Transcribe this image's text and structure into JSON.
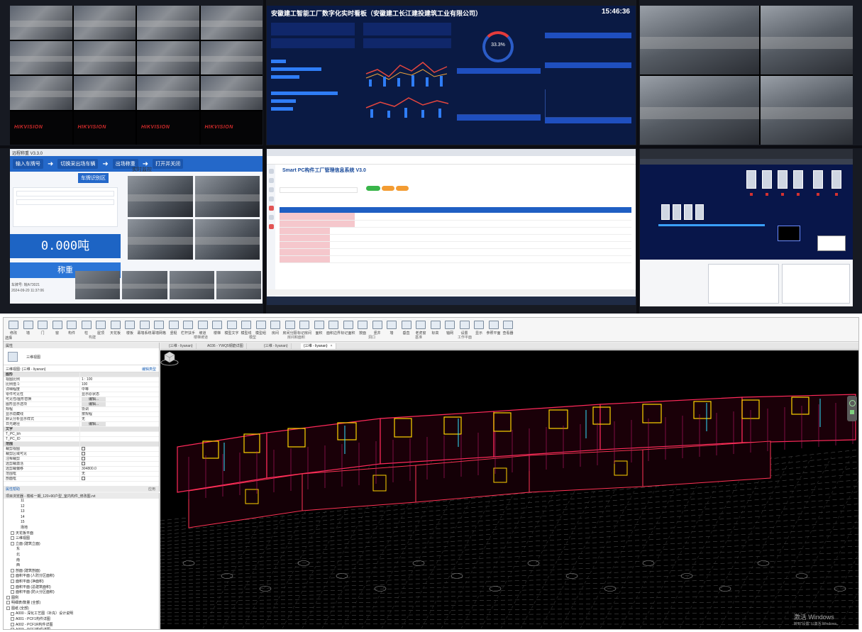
{
  "dashboard": {
    "title": "安徽建工智能工厂数字化实时看板（安徽建工长江建投建筑工业有限公司）",
    "time": "15:46:36",
    "efficiency": "33.3%"
  },
  "weighbridge": {
    "app_title": "远程称重 V3.3.0",
    "steps": [
      "输入车牌号",
      "切换采出场车辆",
      "出场称重",
      "打开并关闭"
    ],
    "plate_tab": "车牌识别区",
    "monitor_title": "实时监控",
    "weight": "0.000吨",
    "weigh_button": "称重",
    "info_lines": [
      "车牌号: 皖A73021",
      "2024-09-20 11:37:06"
    ]
  },
  "management": {
    "system_title": "Smart PC构件工厂管理信息系统 V3.0"
  },
  "revit": {
    "ribbon": {
      "buttons": [
        "修改",
        "墙",
        "门",
        "窗",
        "构件",
        "柱",
        "屋顶",
        "天花板",
        "楼板",
        "幕墙系统",
        "幕墙网格",
        "竖梃",
        "栏杆扶手",
        "坡道",
        "楼梯",
        "模型文字",
        "模型线",
        "模型组",
        "房间",
        "房间分隔",
        "标记房间",
        "面积",
        "面积边界",
        "标记面积",
        "按面",
        "竖井",
        "墙",
        "垂直",
        "老虎窗",
        "标高",
        "轴网",
        "设置",
        "显示",
        "参照平面",
        "查看器"
      ],
      "groups": [
        "构建",
        "楼梯坡道",
        "模型",
        "房间和面积",
        "洞口",
        "基准",
        "工作平面"
      ],
      "select": "选择"
    },
    "properties": {
      "title": "属性",
      "type_name": "三维视图",
      "selector": "三维视图: {三维 - liyanan}",
      "edit_type": "编辑类型",
      "rows": [
        {
          "k": "图形",
          "v": "",
          "cat": true
        },
        {
          "k": "视图比例",
          "v": "1 : 100"
        },
        {
          "k": "比例值 1:",
          "v": "100"
        },
        {
          "k": "详细程度",
          "v": "中等"
        },
        {
          "k": "零件可见性",
          "v": "显示原状态"
        },
        {
          "k": "可见性/图形替换",
          "v": "编辑..."
        },
        {
          "k": "图形显示选项",
          "v": "编辑..."
        },
        {
          "k": "规程",
          "v": "协调"
        },
        {
          "k": "显示隐藏线",
          "v": "按规程"
        },
        {
          "k": "默认分析显示样式",
          "v": "无"
        },
        {
          "k": "日光路径",
          "v": "编辑..."
        },
        {
          "k": "文字",
          "v": "",
          "cat": true
        },
        {
          "k": "T_PC_bh",
          "v": ""
        },
        {
          "k": "T_PC_ID",
          "v": ""
        },
        {
          "k": "范围",
          "v": "",
          "cat": true
        },
        {
          "k": "裁剪视图",
          "v": "[ ]"
        },
        {
          "k": "裁剪区域可见",
          "v": "[ ]"
        },
        {
          "k": "注释裁剪",
          "v": "[ ]"
        },
        {
          "k": "远剪裁激活",
          "v": "[ ]"
        },
        {
          "k": "远剪裁偏移",
          "v": "304800.0"
        },
        {
          "k": "范围框",
          "v": "无"
        },
        {
          "k": "剖面框",
          "v": "[ ]"
        }
      ],
      "help": "属性帮助",
      "apply": "应用"
    },
    "browser": {
      "title": "项目浏览器 - 楼栋一期_120+90户型_室内构件_修改图.rvt",
      "items": [
        "11",
        "12",
        "13",
        "14",
        "15",
        "场地",
        "天花板平面",
        "三维视图",
        "立面 (建筑立面)",
        "东",
        "北",
        "南",
        "西",
        "剖面 (建筑剖面)",
        "面积平面 (人防分区面积)",
        "面积平面 (净面积)",
        "面积平面 (总建筑面积)",
        "面积平面 (防火分区面积)",
        "图例",
        "明细表/数量 (全部)",
        "图纸 (全部)",
        "A000 - 深化工艺图（补充）设计说明",
        "A001 - PCF1构件详图",
        "A002 - PCF1R构件详图",
        "A003 - PCF2构件详图"
      ]
    },
    "tabs": [
      {
        "label": "{三维 - liyanan}",
        "active": false
      },
      {
        "label": "A036 - YWQ5钢筋详图",
        "active": false
      },
      {
        "label": "{三维 - liyanan}",
        "active": false
      },
      {
        "label": "{三维 - liyanan}",
        "active": true
      }
    ],
    "watermark": {
      "line1": "激活 Windows",
      "line2": "转到\"设置\"以激活 Windows。"
    }
  }
}
